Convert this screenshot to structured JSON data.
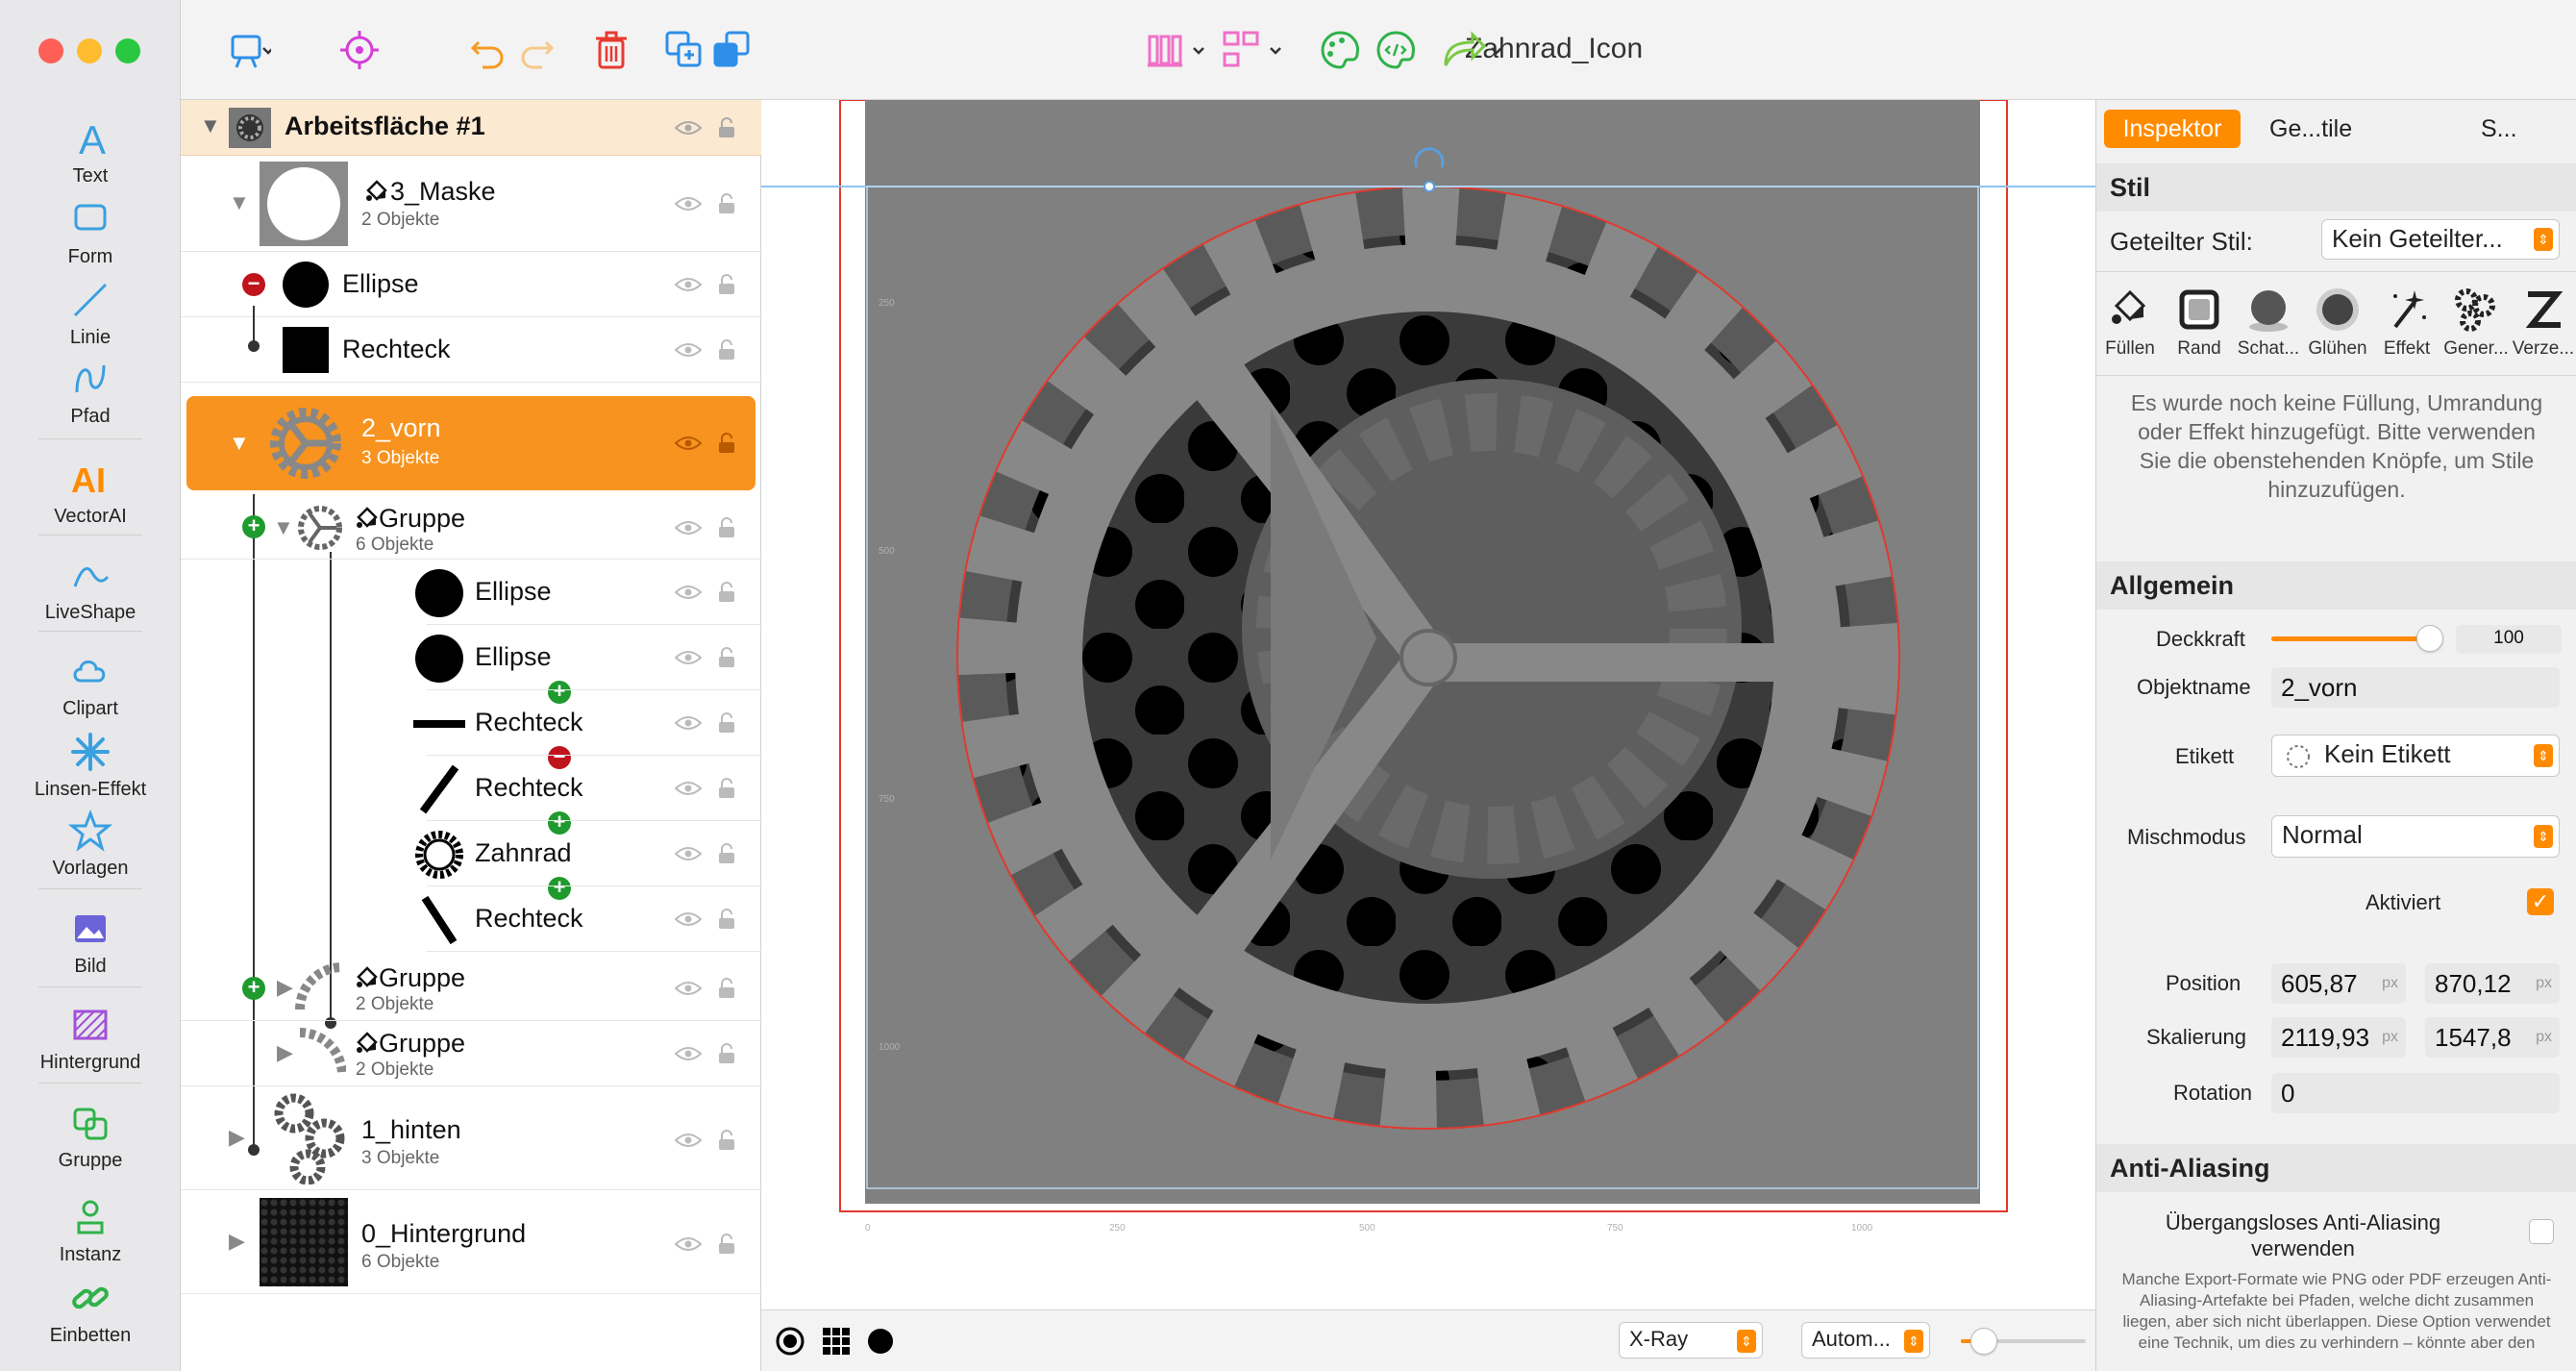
{
  "window": {
    "title": "Zahnrad_Icon"
  },
  "tools": [
    {
      "label": "Text",
      "icon": "text-tool-icon"
    },
    {
      "label": "Form",
      "icon": "shape-tool-icon"
    },
    {
      "label": "Linie",
      "icon": "line-tool-icon"
    },
    {
      "label": "Pfad",
      "icon": "path-tool-icon"
    },
    {
      "label": "VectorAI",
      "icon": "vectorai-icon"
    },
    {
      "label": "LiveShape",
      "icon": "liveshape-icon"
    },
    {
      "label": "Clipart",
      "icon": "clipart-icon"
    },
    {
      "label": "Linsen-Effekt",
      "icon": "lens-effect-icon"
    },
    {
      "label": "Vorlagen",
      "icon": "templates-icon"
    },
    {
      "label": "Bild",
      "icon": "image-icon"
    },
    {
      "label": "Hintergrund",
      "icon": "background-icon"
    },
    {
      "label": "Gruppe",
      "icon": "group-icon"
    },
    {
      "label": "Instanz",
      "icon": "instance-icon"
    },
    {
      "label": "Einbetten",
      "icon": "embed-icon"
    }
  ],
  "colors": {
    "accent": "#FF8C00",
    "selection": "#F7931E",
    "artboard_header": "#FCE9D2",
    "canvas_gray": "#808080"
  },
  "layers": {
    "artboard": "Arbeitsfläche #1",
    "rows": [
      {
        "name": "3_Maske",
        "sub": "2 Objekte"
      },
      {
        "name": "Ellipse",
        "sub": ""
      },
      {
        "name": "Rechteck",
        "sub": ""
      },
      {
        "name": "2_vorn",
        "sub": "3 Objekte"
      },
      {
        "name": "Gruppe",
        "sub": "6 Objekte"
      },
      {
        "name": "Ellipse",
        "sub": ""
      },
      {
        "name": "Ellipse",
        "sub": ""
      },
      {
        "name": "Rechteck",
        "sub": ""
      },
      {
        "name": "Rechteck",
        "sub": ""
      },
      {
        "name": "Zahnrad",
        "sub": ""
      },
      {
        "name": "Rechteck",
        "sub": ""
      },
      {
        "name": "Gruppe",
        "sub": "2 Objekte"
      },
      {
        "name": "Gruppe",
        "sub": "2 Objekte"
      },
      {
        "name": "1_hinten",
        "sub": "3 Objekte"
      },
      {
        "name": "0_Hintergrund",
        "sub": "6 Objekte"
      }
    ]
  },
  "canvas": {
    "ruler_v": [
      "250",
      "500",
      "750",
      "1000"
    ],
    "ruler_h": [
      "0",
      "250",
      "500",
      "750",
      "1000"
    ]
  },
  "bottombar": {
    "view_mode": "X-Ray",
    "zoom": "Autom..."
  },
  "inspector": {
    "tabs": [
      "Inspektor",
      "Ge...tile",
      "S..."
    ],
    "stil_header": "Stil",
    "shared_style_label": "Geteilter Stil:",
    "shared_style_value": "Kein Geteilter...",
    "style_buttons": [
      "Füllen",
      "Rand",
      "Schat...",
      "Glühen",
      "Effekt",
      "Gener...",
      "Verze..."
    ],
    "no_style_text": "Es wurde noch keine Füllung, Umrandung oder Effekt hinzugefügt. Bitte verwenden Sie die obenstehenden Knöpfe, um Stile hinzuzufügen.",
    "allgemein_header": "Allgemein",
    "opacity_label": "Deckkraft",
    "opacity_value": "100",
    "opacity_fraction": 0.98,
    "name_label": "Objektname",
    "name_value": "2_vorn",
    "tag_label": "Etikett",
    "tag_value": "Kein Etikett",
    "blend_label": "Mischmodus",
    "blend_value": "Normal",
    "enabled_label": "Aktiviert",
    "position_label": "Position",
    "position_x": "605,87",
    "position_y": "870,12",
    "scale_label": "Skalierung",
    "scale_x": "2119,93",
    "scale_y": "1547,8",
    "rotation_label": "Rotation",
    "rotation_value": "0",
    "unit": "px",
    "aa_header": "Anti-Aliasing",
    "aa_label": "Übergangsloses Anti-Aliasing verwenden",
    "aa_help": "Manche Export-Formate wie PNG oder PDF erzeugen Anti-Aliasing-Artefakte bei Pfaden, welche dicht zusammen liegen, aber sich nicht überlappen. Diese Option verwendet eine Technik, um dies zu verhindern – könnte aber den"
  }
}
